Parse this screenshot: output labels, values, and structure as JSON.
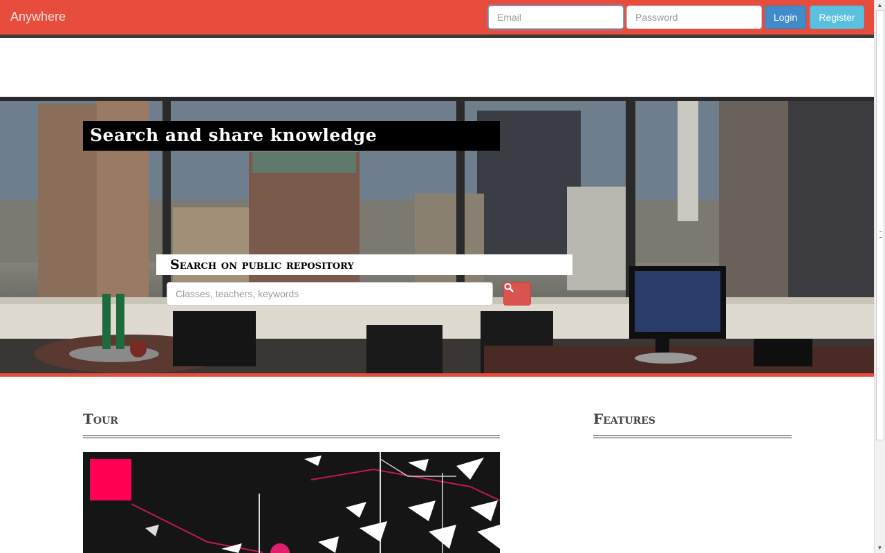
{
  "navbar": {
    "brand": "Anywhere",
    "email_placeholder": "Email",
    "password_placeholder": "Password",
    "login_label": "Login",
    "register_label": "Register"
  },
  "hero": {
    "headline": "Search and share knowledge",
    "search_label": "Search on public repository",
    "search_placeholder": "Classes, teachers, keywords",
    "search_icon": "search-icon"
  },
  "sections": {
    "tour_title": "Tour",
    "features_title": "Features"
  },
  "colors": {
    "brand_red": "#e74c3c",
    "primary": "#428bca",
    "info": "#5bc0de",
    "danger": "#d9534f",
    "accent_pink": "#ff0055"
  }
}
